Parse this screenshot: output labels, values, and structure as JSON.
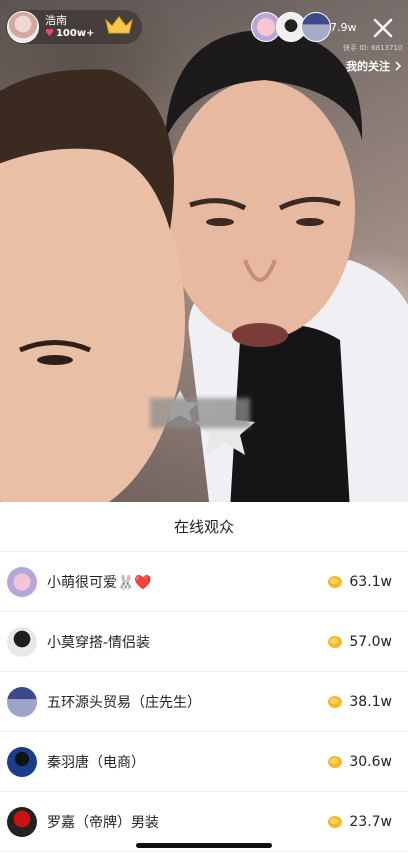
{
  "host": {
    "name": "浩南",
    "likes": "100w+"
  },
  "viewers": {
    "count": "7.9w"
  },
  "kuaishou_id_label": "快手 ID: 6813710",
  "follow_link": "我的关注",
  "sheet": {
    "title": "在线观众",
    "rows": [
      {
        "name": "小萌很可爱🐰❤️",
        "score": "63.1w"
      },
      {
        "name": "小莫穿搭-情侣装",
        "score": "57.0w"
      },
      {
        "name": "五环源头贸易（庄先生）",
        "score": "38.1w"
      },
      {
        "name": "秦羽唐（电商）",
        "score": "30.6w"
      },
      {
        "name": "罗嘉（帝牌）男装",
        "score": "23.7w"
      }
    ]
  },
  "colors": {
    "heart": "#ff4466",
    "coin": "#f5b82a",
    "sheet_bg": "#ffffff"
  },
  "icons": [
    "heart-icon",
    "crown-icon",
    "close-icon",
    "chevron-right-icon",
    "coin-icon"
  ]
}
